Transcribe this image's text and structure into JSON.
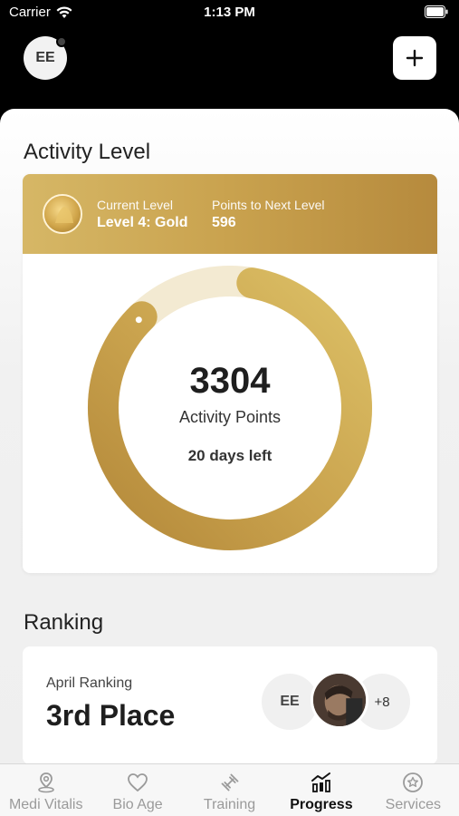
{
  "status_bar": {
    "carrier": "Carrier",
    "time": "1:13 PM"
  },
  "header": {
    "avatar_initials": "EE"
  },
  "activity": {
    "title": "Activity Level",
    "current_level_label": "Current Level",
    "current_level_value": "Level 4: Gold",
    "points_next_label": "Points to Next Level",
    "points_next_value": "596",
    "points": "3304",
    "points_label": "Activity Points",
    "days_left": "20 days left",
    "progress_fraction": 0.85
  },
  "ranking": {
    "title": "Ranking",
    "month": "April Ranking",
    "place": "3rd Place",
    "initials": "EE",
    "more": "+8"
  },
  "tabs": [
    {
      "label": "Medi Vitalis",
      "icon": "location-pin-icon"
    },
    {
      "label": "Bio Age",
      "icon": "heart-icon"
    },
    {
      "label": "Training",
      "icon": "dumbbell-icon"
    },
    {
      "label": "Progress",
      "icon": "chart-icon",
      "active": true
    },
    {
      "label": "Services",
      "icon": "star-badge-icon"
    }
  ],
  "colors": {
    "gold_light": "#d9bd66",
    "gold_dark": "#b68a3d",
    "ring_track": "#f3ead2"
  }
}
